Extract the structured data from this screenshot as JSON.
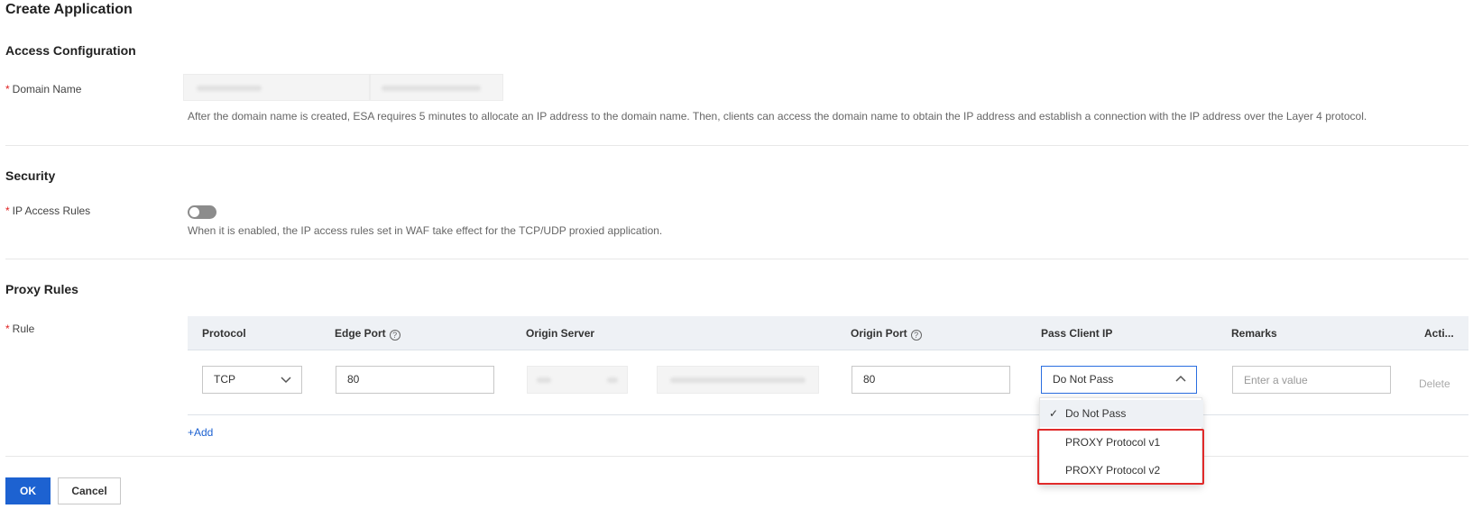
{
  "page": {
    "title": "Create Application"
  },
  "access": {
    "section_title": "Access Configuration",
    "domain_label": "Domain Name",
    "domain_help": "After the domain name is created, ESA requires 5 minutes to allocate an IP address to the domain name. Then, clients can access the domain name to obtain the IP address and establish a connection with the IP address over the Layer 4 protocol."
  },
  "security": {
    "section_title": "Security",
    "ip_rules_label": "IP Access Rules",
    "ip_rules_help": "When it is enabled, the IP access rules set in WAF take effect for the TCP/UDP proxied application.",
    "ip_rules_enabled": false
  },
  "proxy": {
    "section_title": "Proxy Rules",
    "rule_label": "Rule",
    "columns": {
      "protocol": "Protocol",
      "edge_port": "Edge Port",
      "origin_server": "Origin Server",
      "origin_port": "Origin Port",
      "pass_client_ip": "Pass Client IP",
      "remarks": "Remarks",
      "actions": "Acti..."
    },
    "row": {
      "protocol": "TCP",
      "edge_port": "80",
      "origin_port": "80",
      "pass_client_ip": "Do Not Pass",
      "remarks_placeholder": "Enter a value",
      "delete_label": "Delete"
    },
    "add_label": "+Add",
    "pass_client_ip_options": [
      "Do Not Pass",
      "PROXY Protocol v1",
      "PROXY Protocol v2"
    ]
  },
  "footer": {
    "ok_label": "OK",
    "cancel_label": "Cancel"
  },
  "colors": {
    "primary": "#1d62d1",
    "required": "#e02020",
    "highlight": "#e02a2a"
  }
}
